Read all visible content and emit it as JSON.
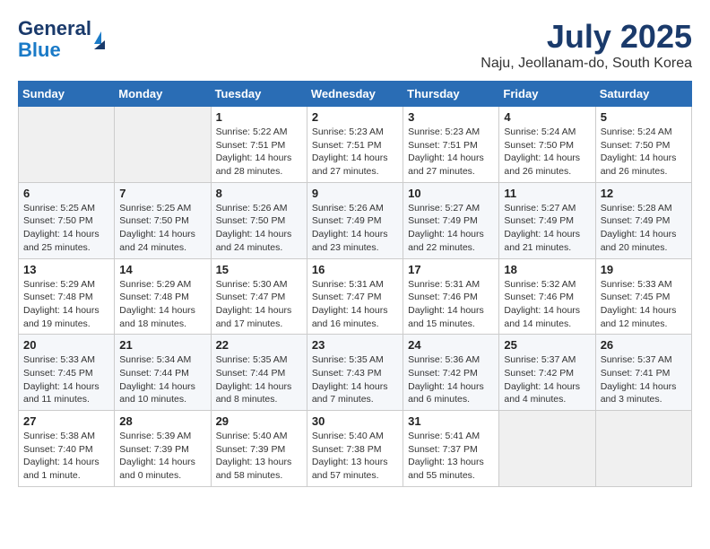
{
  "header": {
    "logo_line1": "General",
    "logo_line2": "Blue",
    "title": "July 2025",
    "subtitle": "Naju, Jeollanam-do, South Korea"
  },
  "calendar": {
    "days_of_week": [
      "Sunday",
      "Monday",
      "Tuesday",
      "Wednesday",
      "Thursday",
      "Friday",
      "Saturday"
    ],
    "weeks": [
      [
        {
          "day": "",
          "empty": true
        },
        {
          "day": "",
          "empty": true
        },
        {
          "day": "1",
          "sunrise": "Sunrise: 5:22 AM",
          "sunset": "Sunset: 7:51 PM",
          "daylight": "Daylight: 14 hours and 28 minutes."
        },
        {
          "day": "2",
          "sunrise": "Sunrise: 5:23 AM",
          "sunset": "Sunset: 7:51 PM",
          "daylight": "Daylight: 14 hours and 27 minutes."
        },
        {
          "day": "3",
          "sunrise": "Sunrise: 5:23 AM",
          "sunset": "Sunset: 7:51 PM",
          "daylight": "Daylight: 14 hours and 27 minutes."
        },
        {
          "day": "4",
          "sunrise": "Sunrise: 5:24 AM",
          "sunset": "Sunset: 7:50 PM",
          "daylight": "Daylight: 14 hours and 26 minutes."
        },
        {
          "day": "5",
          "sunrise": "Sunrise: 5:24 AM",
          "sunset": "Sunset: 7:50 PM",
          "daylight": "Daylight: 14 hours and 26 minutes."
        }
      ],
      [
        {
          "day": "6",
          "sunrise": "Sunrise: 5:25 AM",
          "sunset": "Sunset: 7:50 PM",
          "daylight": "Daylight: 14 hours and 25 minutes."
        },
        {
          "day": "7",
          "sunrise": "Sunrise: 5:25 AM",
          "sunset": "Sunset: 7:50 PM",
          "daylight": "Daylight: 14 hours and 24 minutes."
        },
        {
          "day": "8",
          "sunrise": "Sunrise: 5:26 AM",
          "sunset": "Sunset: 7:50 PM",
          "daylight": "Daylight: 14 hours and 24 minutes."
        },
        {
          "day": "9",
          "sunrise": "Sunrise: 5:26 AM",
          "sunset": "Sunset: 7:49 PM",
          "daylight": "Daylight: 14 hours and 23 minutes."
        },
        {
          "day": "10",
          "sunrise": "Sunrise: 5:27 AM",
          "sunset": "Sunset: 7:49 PM",
          "daylight": "Daylight: 14 hours and 22 minutes."
        },
        {
          "day": "11",
          "sunrise": "Sunrise: 5:27 AM",
          "sunset": "Sunset: 7:49 PM",
          "daylight": "Daylight: 14 hours and 21 minutes."
        },
        {
          "day": "12",
          "sunrise": "Sunrise: 5:28 AM",
          "sunset": "Sunset: 7:49 PM",
          "daylight": "Daylight: 14 hours and 20 minutes."
        }
      ],
      [
        {
          "day": "13",
          "sunrise": "Sunrise: 5:29 AM",
          "sunset": "Sunset: 7:48 PM",
          "daylight": "Daylight: 14 hours and 19 minutes."
        },
        {
          "day": "14",
          "sunrise": "Sunrise: 5:29 AM",
          "sunset": "Sunset: 7:48 PM",
          "daylight": "Daylight: 14 hours and 18 minutes."
        },
        {
          "day": "15",
          "sunrise": "Sunrise: 5:30 AM",
          "sunset": "Sunset: 7:47 PM",
          "daylight": "Daylight: 14 hours and 17 minutes."
        },
        {
          "day": "16",
          "sunrise": "Sunrise: 5:31 AM",
          "sunset": "Sunset: 7:47 PM",
          "daylight": "Daylight: 14 hours and 16 minutes."
        },
        {
          "day": "17",
          "sunrise": "Sunrise: 5:31 AM",
          "sunset": "Sunset: 7:46 PM",
          "daylight": "Daylight: 14 hours and 15 minutes."
        },
        {
          "day": "18",
          "sunrise": "Sunrise: 5:32 AM",
          "sunset": "Sunset: 7:46 PM",
          "daylight": "Daylight: 14 hours and 14 minutes."
        },
        {
          "day": "19",
          "sunrise": "Sunrise: 5:33 AM",
          "sunset": "Sunset: 7:45 PM",
          "daylight": "Daylight: 14 hours and 12 minutes."
        }
      ],
      [
        {
          "day": "20",
          "sunrise": "Sunrise: 5:33 AM",
          "sunset": "Sunset: 7:45 PM",
          "daylight": "Daylight: 14 hours and 11 minutes."
        },
        {
          "day": "21",
          "sunrise": "Sunrise: 5:34 AM",
          "sunset": "Sunset: 7:44 PM",
          "daylight": "Daylight: 14 hours and 10 minutes."
        },
        {
          "day": "22",
          "sunrise": "Sunrise: 5:35 AM",
          "sunset": "Sunset: 7:44 PM",
          "daylight": "Daylight: 14 hours and 8 minutes."
        },
        {
          "day": "23",
          "sunrise": "Sunrise: 5:35 AM",
          "sunset": "Sunset: 7:43 PM",
          "daylight": "Daylight: 14 hours and 7 minutes."
        },
        {
          "day": "24",
          "sunrise": "Sunrise: 5:36 AM",
          "sunset": "Sunset: 7:42 PM",
          "daylight": "Daylight: 14 hours and 6 minutes."
        },
        {
          "day": "25",
          "sunrise": "Sunrise: 5:37 AM",
          "sunset": "Sunset: 7:42 PM",
          "daylight": "Daylight: 14 hours and 4 minutes."
        },
        {
          "day": "26",
          "sunrise": "Sunrise: 5:37 AM",
          "sunset": "Sunset: 7:41 PM",
          "daylight": "Daylight: 14 hours and 3 minutes."
        }
      ],
      [
        {
          "day": "27",
          "sunrise": "Sunrise: 5:38 AM",
          "sunset": "Sunset: 7:40 PM",
          "daylight": "Daylight: 14 hours and 1 minute."
        },
        {
          "day": "28",
          "sunrise": "Sunrise: 5:39 AM",
          "sunset": "Sunset: 7:39 PM",
          "daylight": "Daylight: 14 hours and 0 minutes."
        },
        {
          "day": "29",
          "sunrise": "Sunrise: 5:40 AM",
          "sunset": "Sunset: 7:39 PM",
          "daylight": "Daylight: 13 hours and 58 minutes."
        },
        {
          "day": "30",
          "sunrise": "Sunrise: 5:40 AM",
          "sunset": "Sunset: 7:38 PM",
          "daylight": "Daylight: 13 hours and 57 minutes."
        },
        {
          "day": "31",
          "sunrise": "Sunrise: 5:41 AM",
          "sunset": "Sunset: 7:37 PM",
          "daylight": "Daylight: 13 hours and 55 minutes."
        },
        {
          "day": "",
          "empty": true
        },
        {
          "day": "",
          "empty": true
        }
      ]
    ]
  }
}
